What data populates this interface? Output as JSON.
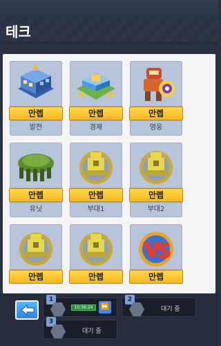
{
  "header": {
    "title": "테크"
  },
  "tiles": [
    {
      "name": "발전",
      "button": "만렙",
      "icon": "power-building-icon"
    },
    {
      "name": "경제",
      "button": "만렙",
      "icon": "economy-building-icon"
    },
    {
      "name": "영웅",
      "button": "만렙",
      "icon": "hero-robot-icon"
    },
    {
      "name": "유닛",
      "button": "만렙",
      "icon": "unit-tank-icon"
    },
    {
      "name": "부대1",
      "button": "만렙",
      "icon": "squad-coin-icon"
    },
    {
      "name": "부대2",
      "button": "만렙",
      "icon": "squad-coin-icon"
    },
    {
      "name": "",
      "button": "만렙",
      "icon": "squad-coin-icon"
    },
    {
      "name": "",
      "button": "만렙",
      "icon": "squad-coin-icon"
    },
    {
      "name": "",
      "button": "만렙",
      "icon": "vs-icon"
    }
  ],
  "queue": [
    {
      "slot": "1",
      "timer": "10:36:24",
      "status": ""
    },
    {
      "slot": "2",
      "status": "대기 중"
    },
    {
      "slot": "3",
      "status": "대기 중"
    }
  ],
  "colors": {
    "button_yellow": "#f5b81f",
    "tile_bg": "#b8c4d9",
    "accent_blue": "#3d8ae0"
  }
}
